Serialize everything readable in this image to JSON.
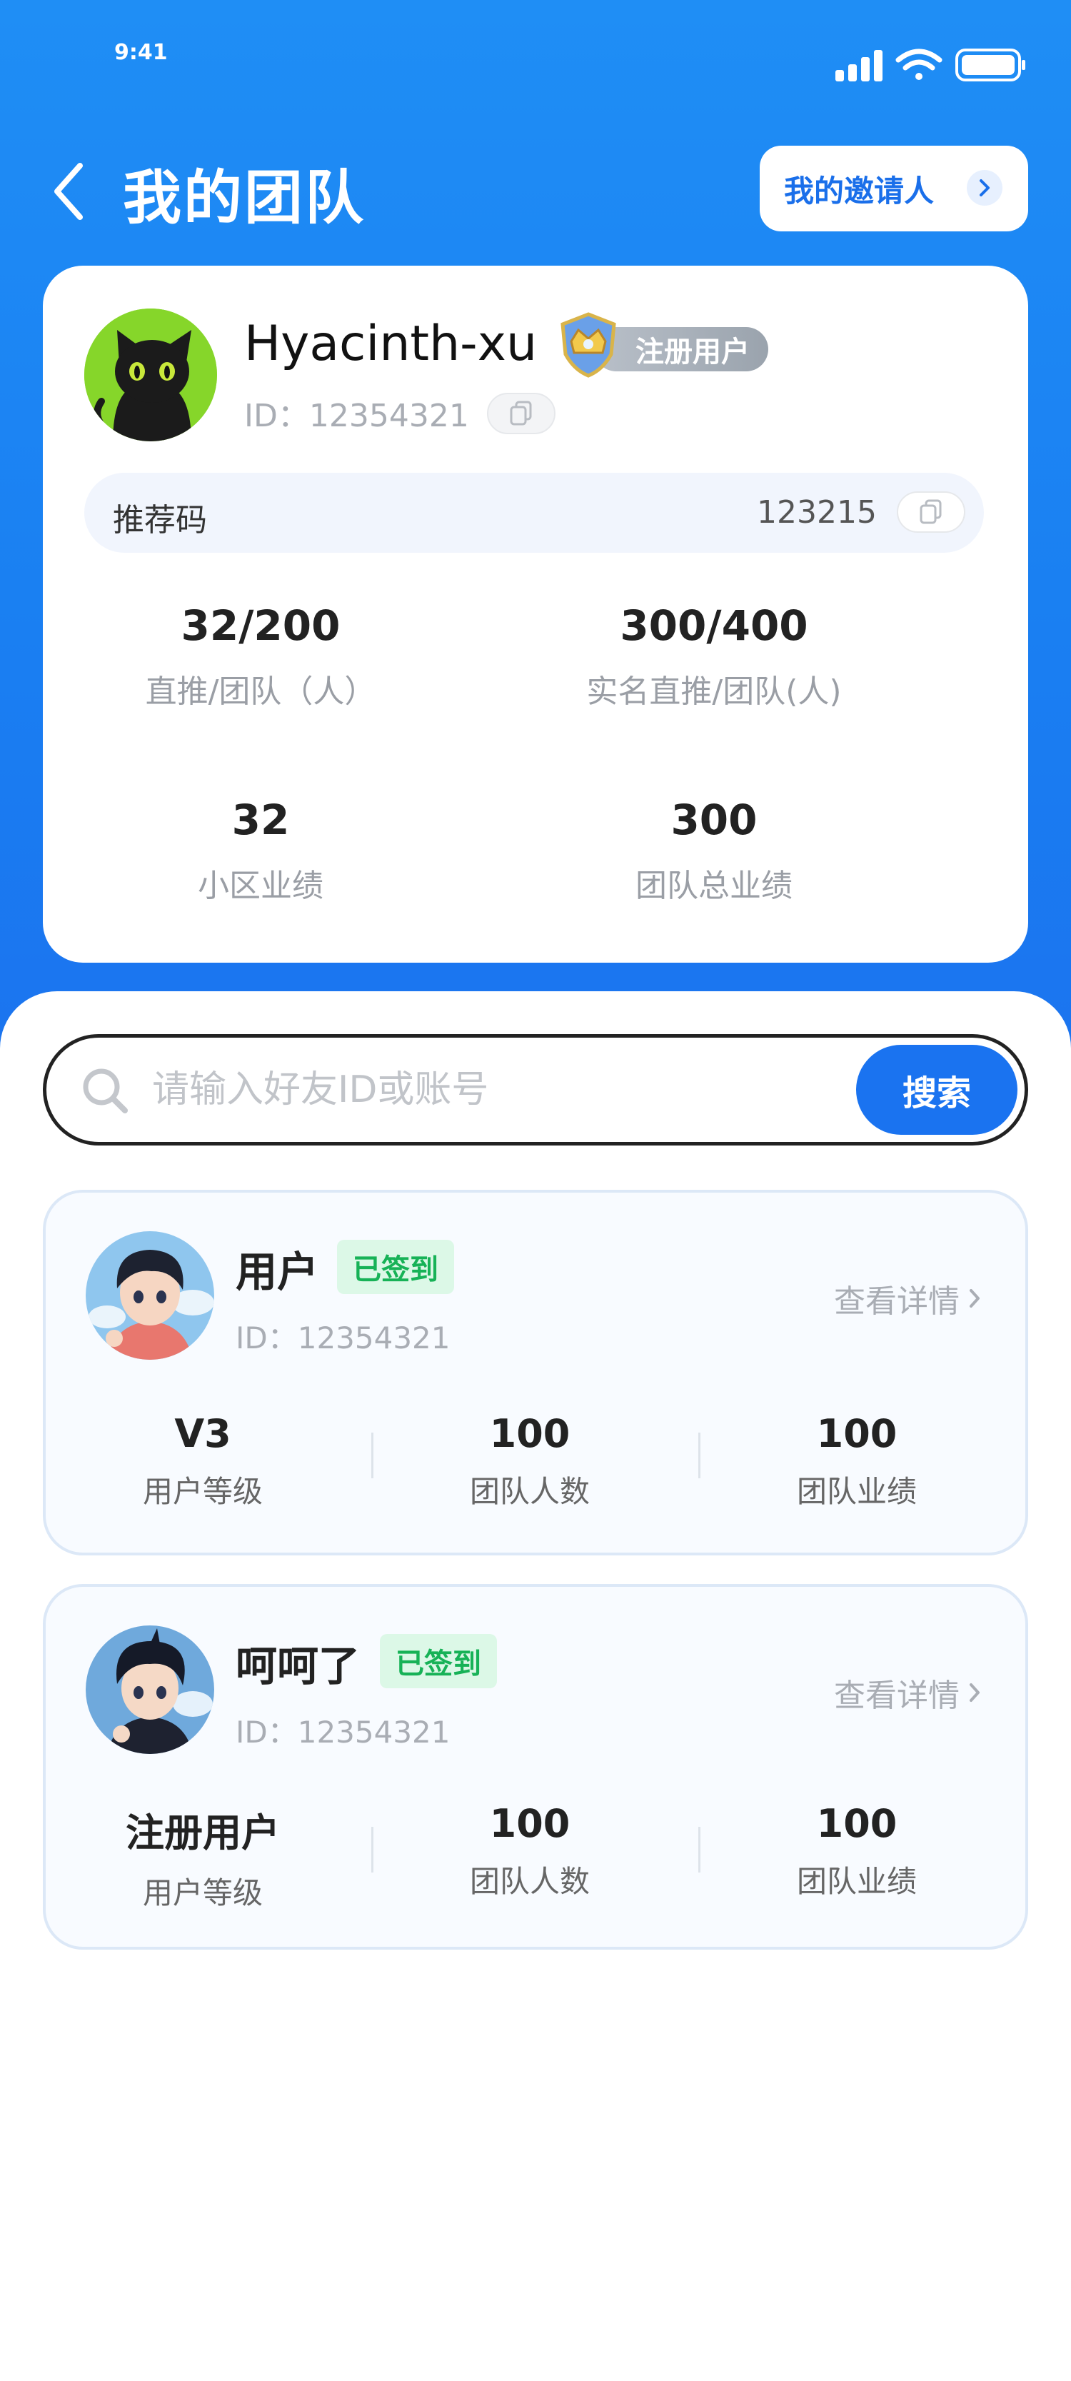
{
  "status_bar": {
    "time": "9:41"
  },
  "header": {
    "title": "我的团队",
    "inviter_button": "我的邀请人"
  },
  "profile": {
    "username": "Hyacinth-xu",
    "level_badge": "注册用户",
    "id_text": "ID：12354321",
    "referral_label": "推荐码",
    "referral_code": "123215",
    "stats": [
      {
        "value": "32/200",
        "label": "直推/团队（人）"
      },
      {
        "value": "300/400",
        "label": "实名直推/团队(人)"
      },
      {
        "value": "32",
        "label": "小区业绩"
      },
      {
        "value": "300",
        "label": "团队总业绩"
      }
    ]
  },
  "search": {
    "placeholder": "请输入好友ID或账号",
    "button": "搜索"
  },
  "members": [
    {
      "name": "用户",
      "status": "已签到",
      "id_text": "ID：12354321",
      "detail": "查看详情",
      "stats": [
        {
          "value": "V3",
          "label": "用户等级"
        },
        {
          "value": "100",
          "label": "团队人数"
        },
        {
          "value": "100",
          "label": "团队业绩"
        }
      ]
    },
    {
      "name": "呵呵了",
      "status": "已签到",
      "id_text": "ID：12354321",
      "detail": "查看详情",
      "stats": [
        {
          "value": "注册用户",
          "label": "用户等级"
        },
        {
          "value": "100",
          "label": "团队人数"
        },
        {
          "value": "100",
          "label": "团队业绩"
        }
      ]
    }
  ],
  "colors": {
    "primary": "#1a73f0",
    "signed_bg": "#dcf8e7",
    "signed_text": "#17b257"
  }
}
